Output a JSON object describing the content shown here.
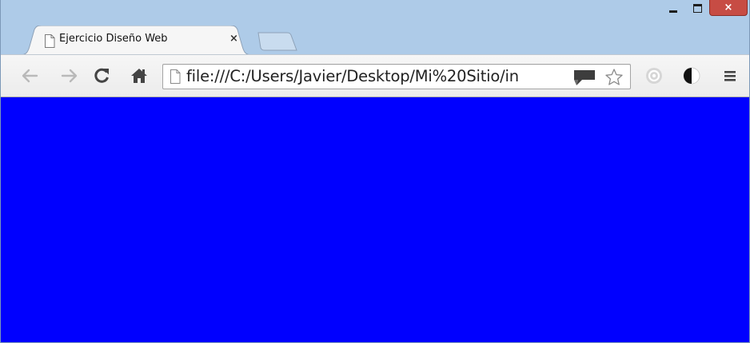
{
  "window": {
    "controls": {
      "minimize_icon": "minimize-icon",
      "maximize_icon": "maximize-icon",
      "close_label": "×"
    }
  },
  "tabs": [
    {
      "title": "Ejercicio Diseño Web",
      "close_label": "×",
      "icon": "page-icon",
      "active": true
    }
  ],
  "new_tab_icon": "new-tab-icon",
  "toolbar": {
    "back_icon": "back-arrow-icon",
    "forward_icon": "forward-arrow-icon",
    "reload_icon": "reload-icon",
    "home_icon": "home-icon",
    "address": {
      "url": "file:///C:/Users/Javier/Desktop/Mi%20Sitio/in",
      "page_icon": "page-icon",
      "chat_icon": "speech-bubble-icon",
      "star_icon": "bookmark-star-icon"
    },
    "extension_icons": [
      "circle-extension-icon",
      "contrast-icon"
    ],
    "menu_icon": "hamburger-menu-icon"
  },
  "content": {
    "background_color": "#0000ff"
  },
  "colors": {
    "frame": "#aecbe8",
    "close_button": "#c74c44",
    "toolbar": "#f2f2f2"
  }
}
